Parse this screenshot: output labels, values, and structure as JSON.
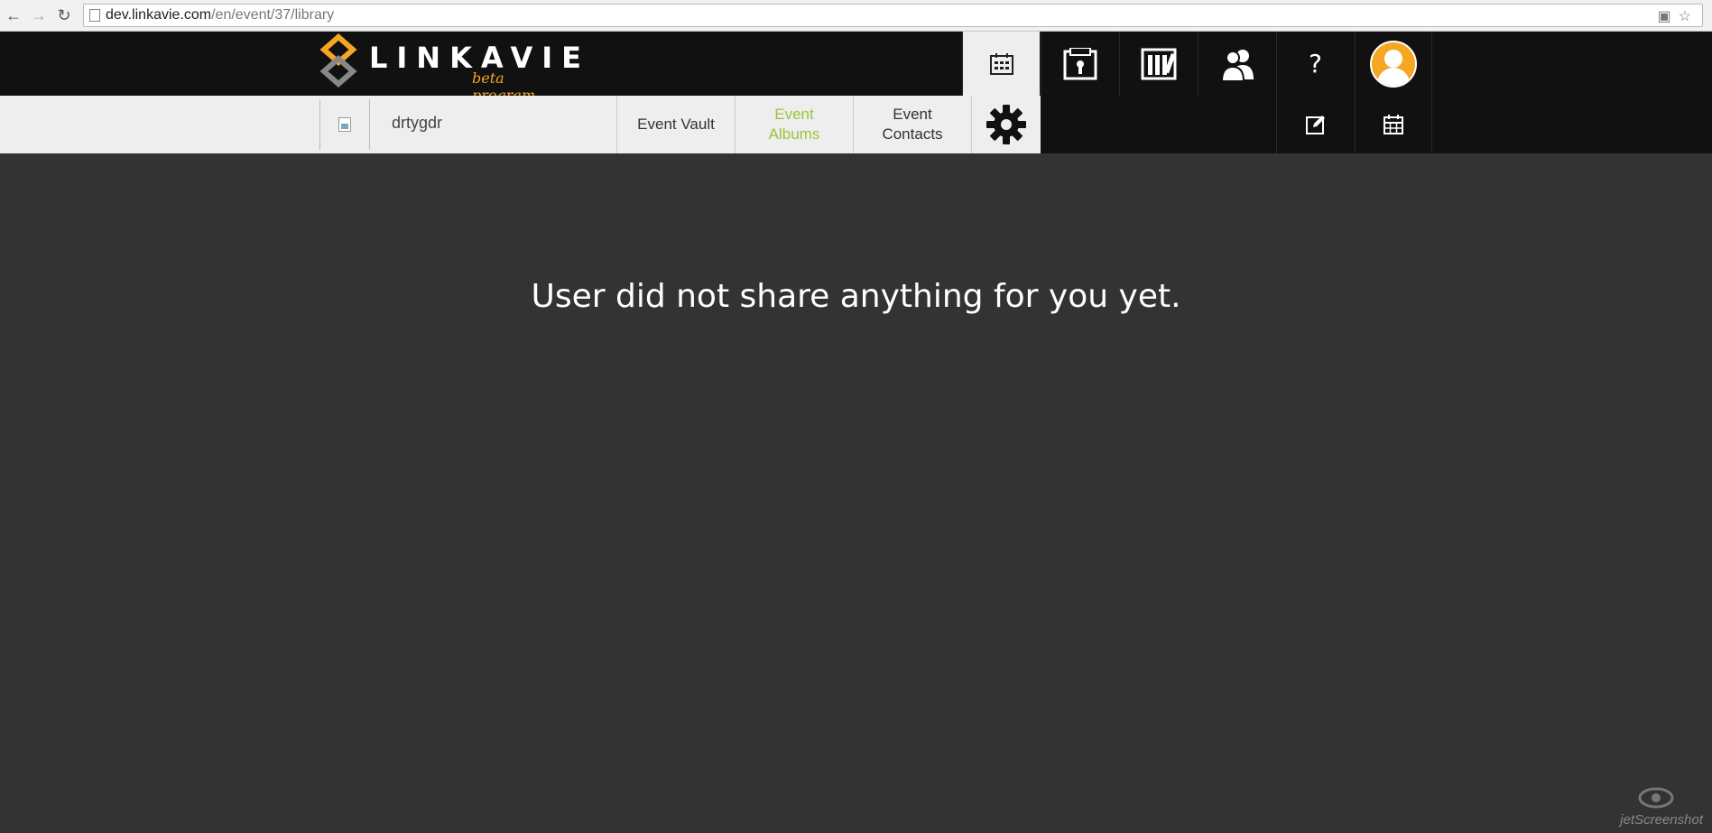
{
  "browser": {
    "url_host": "dev.linkavie.com",
    "url_path": "/en/event/37/library"
  },
  "brand": {
    "name": "LINKAVIE",
    "subtitle": "beta program"
  },
  "top_nav": {
    "help_label": "?"
  },
  "event": {
    "name": "drtygdr"
  },
  "tabs": [
    {
      "label": "Event Vault"
    },
    {
      "label_line1": "Event",
      "label_line2": "Albums"
    },
    {
      "label_line1": "Event",
      "label_line2": "Contacts"
    }
  ],
  "main": {
    "message": "User did not share anything for you yet."
  },
  "watermark": {
    "text": "jetScreenshot"
  },
  "colors": {
    "accent_orange": "#f5a623",
    "active_tab_green": "#9bc43d",
    "header_black": "#111111",
    "content_bg": "#333333"
  }
}
